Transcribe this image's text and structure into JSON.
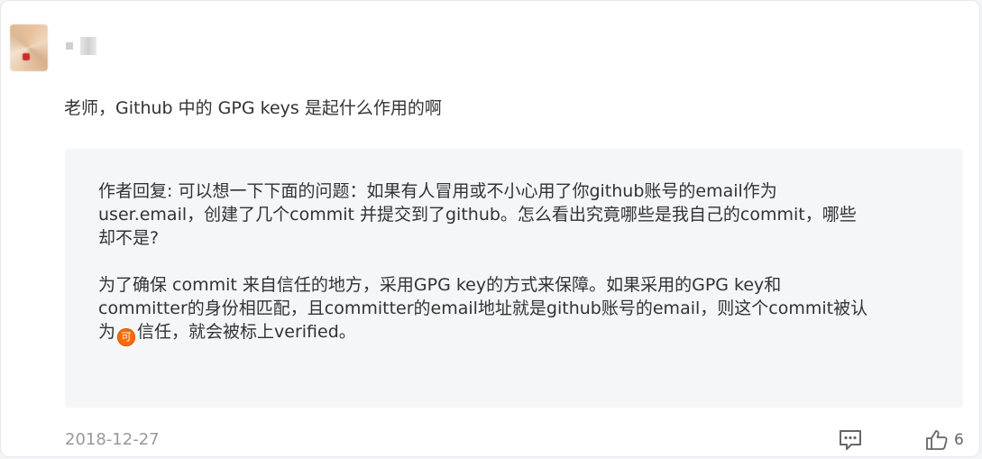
{
  "comment": {
    "question": "老师，Github 中的 GPG keys 是起什么作用的啊",
    "date": "2018-12-27",
    "like_count": "6"
  },
  "reply": {
    "p1_line1": "作者回复: 可以想一下下面的问题：如果有人冒用或不小心用了你github账号的email作为",
    "p1_line2": "user.email，创建了几个commit 并提交到了github。怎么看出究竟哪些是我自己的commit，哪些",
    "p1_line3": "却不是?",
    "p2_line1": "为了确保 commit 来自信任的地方，采用GPG key的方式来保障。如果采用的GPG key和",
    "p2_line2": "committer的身份相匹配，且committer的email地址就是github账号的email，则这个commit被认",
    "p2_line3_before": "为",
    "p2_icon_glyph": "可",
    "p2_line3_after": "信任，就会被标上verified。"
  },
  "icons": {
    "comment": "comment-icon",
    "like": "thumbs-up-icon",
    "inline": "orange-badge-icon"
  },
  "colors": {
    "text": "#333333",
    "muted": "#999999",
    "reply_bg": "#f5f6f8",
    "badge": "#ff6a00"
  }
}
